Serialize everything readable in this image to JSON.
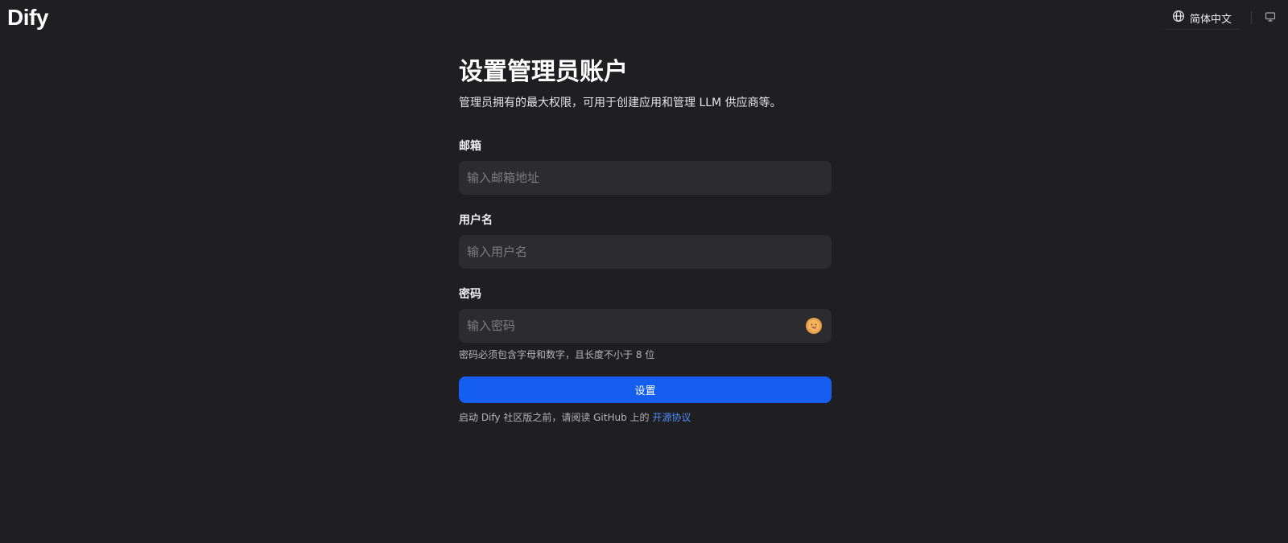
{
  "header": {
    "logo_text": "Dify",
    "language": {
      "label": "简体中文",
      "icon": "globe-icon"
    },
    "theme_icon": "monitor-icon"
  },
  "page": {
    "title": "设置管理员账户",
    "subtitle": "管理员拥有的最大权限，可用于创建应用和管理 LLM 供应商等。"
  },
  "form": {
    "email": {
      "label": "邮箱",
      "placeholder": "输入邮箱地址",
      "value": ""
    },
    "username": {
      "label": "用户名",
      "placeholder": "输入用户名",
      "value": ""
    },
    "password": {
      "label": "密码",
      "placeholder": "输入密码",
      "value": "",
      "toggle_icon": "show-password-emoji-icon",
      "hint": "密码必须包含字母和数字，且长度不小于 8 位"
    },
    "submit_label": "设置"
  },
  "footer": {
    "prefix": "启动 Dify 社区版之前，请阅读 GitHub 上的 ",
    "link_label": "开源协议"
  },
  "colors": {
    "background": "#1f1f21",
    "input_background": "#2c2c2f",
    "primary": "#155eef",
    "link": "#4e8cff"
  }
}
